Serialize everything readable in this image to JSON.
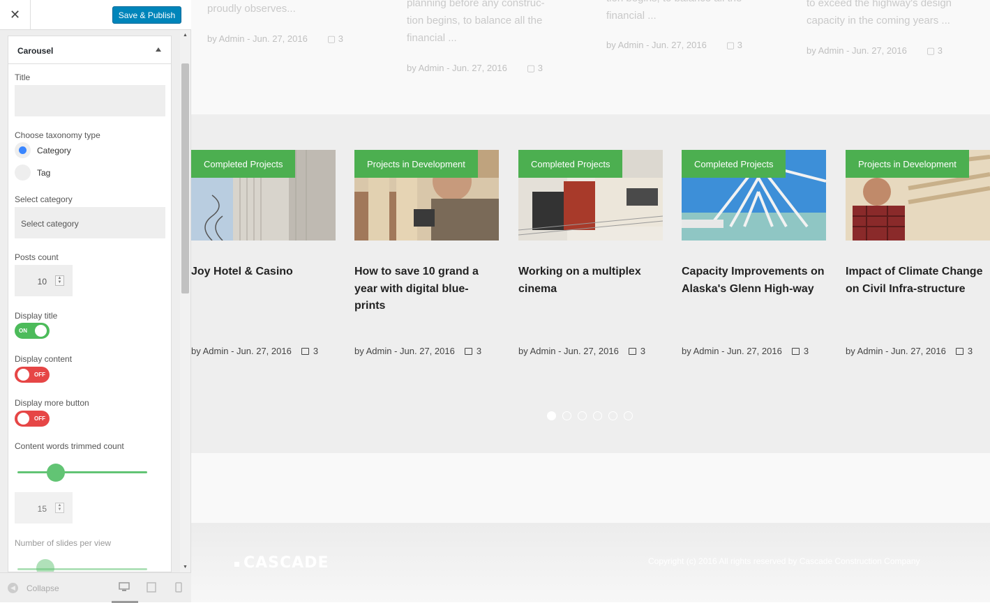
{
  "panel": {
    "close_label": "✕",
    "publish_label": "Save & Publish",
    "section_title": "Carousel",
    "fields": {
      "title_label": "Title",
      "title_value": "",
      "taxonomy_label": "Choose taxonomy type",
      "taxonomy_options": [
        "Category",
        "Tag"
      ],
      "taxonomy_selected": "Category",
      "select_category_label": "Select category",
      "select_category_placeholder": "Select category",
      "posts_count_label": "Posts count",
      "posts_count_value": "10",
      "display_title_label": "Display title",
      "display_title_state": "ON",
      "display_content_label": "Display content",
      "display_content_state": "OFF",
      "display_more_label": "Display more button",
      "display_more_state": "OFF",
      "words_trimmed_label": "Content words trimmed count",
      "words_trimmed_value": "15",
      "slides_per_view_label": "Number of slides per view"
    },
    "footer": {
      "collapse_label": "Collapse"
    }
  },
  "preview": {
    "faded_cards": [
      {
        "excerpt": [
          "proudly observes..."
        ],
        "meta": "by Admin - Jun. 27, 2016",
        "comments": "3"
      },
      {
        "excerpt": [
          "planning before any construc-",
          "tion begins, to balance all the",
          "financial ..."
        ],
        "meta": "by Admin - Jun. 27, 2016",
        "comments": "3"
      },
      {
        "excerpt": [
          "tion begins, to balance all the",
          "financial ..."
        ],
        "meta": "by Admin - Jun. 27, 2016",
        "comments": "3"
      },
      {
        "excerpt": [
          "to exceed the highway's design",
          "capacity in the coming years ..."
        ],
        "meta": "by Admin - Jun. 27, 2016",
        "comments": "3"
      }
    ],
    "cards": [
      {
        "tag": "Completed Projects",
        "title": "Joy Hotel & Casino",
        "meta": "by Admin - Jun. 27, 2016",
        "comments": "3"
      },
      {
        "tag": "Projects in Development",
        "title": "How to save 10 grand a year with digital blue-prints",
        "meta": "by Admin - Jun. 27, 2016",
        "comments": "3"
      },
      {
        "tag": "Completed Projects",
        "title": "Working on a multiplex cinema",
        "meta": "by Admin - Jun. 27, 2016",
        "comments": "3"
      },
      {
        "tag": "Completed Projects",
        "title": "Capacity Improvements on Alaska's Glenn High-way",
        "meta": "by Admin - Jun. 27, 2016",
        "comments": "3"
      },
      {
        "tag": "Projects in Development",
        "title": "Impact of Climate Change on Civil Infra-structure",
        "meta": "by Admin - Jun. 27, 2016",
        "comments": "3"
      }
    ],
    "pagination": {
      "total": 6,
      "active": 1
    },
    "footer": {
      "logo": "CASCADE",
      "copyright": "Copyright (c) 2016 All rights reserved by Cascade Construction Company"
    }
  },
  "colors": {
    "accent_green": "#4caf50",
    "publish_blue": "#0085ba",
    "toggle_on": "#4cbb5a",
    "toggle_off": "#e64646"
  }
}
